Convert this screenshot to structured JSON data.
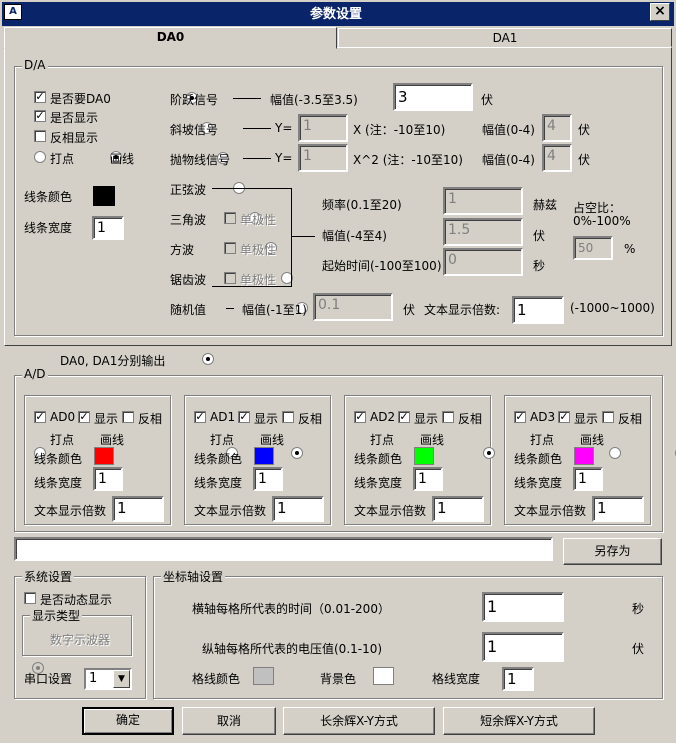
{
  "window": {
    "title": "参数设置",
    "close": "×",
    "icon": "A"
  },
  "tabs": [
    {
      "label": "DA0"
    },
    {
      "label": "DA1"
    }
  ],
  "da": {
    "legend": "D/A",
    "need_da0": "是否要DA0",
    "show": "是否显示",
    "invert": "反相显示",
    "dot": "打点",
    "line": "画线",
    "line_color": "线条颜色",
    "line_width": "线条宽度",
    "line_width_value": "1",
    "line_color_hex": "#000000",
    "step": {
      "label": "阶跃信号",
      "amp_label": "幅值(-3.5至3.5)",
      "amp_value": "3",
      "unit": "伏"
    },
    "ramp": {
      "label": "斜坡信号",
      "y": "Y=",
      "value": "1",
      "x_note": "X  (注：-10至10)",
      "amp": "幅值(0-4)",
      "amp_value": "4",
      "unit": "伏"
    },
    "parabola": {
      "label": "抛物线信号",
      "y": "Y=",
      "value": "1",
      "x_note": "X^2 (注：-10至10)",
      "amp": "幅值(0-4)",
      "amp_value": "4",
      "unit": "伏"
    },
    "sine": "正弦波",
    "triangle": "三角波",
    "square": "方波",
    "sawtooth": "锯齿波",
    "unipolar": "单极性",
    "freq": {
      "label": "频率(0.1至20)",
      "value": "1",
      "unit": "赫兹"
    },
    "amp": {
      "label": "幅值(-4至4)",
      "value": "1.5",
      "unit": "伏"
    },
    "start": {
      "label": "起始时间(-100至100)",
      "value": "0",
      "unit": "秒"
    },
    "duty": {
      "label1": "占空比：",
      "label2": "0%-100%",
      "value": "50",
      "unit": "%"
    },
    "random": {
      "label": "随机值",
      "amp": "幅值(-1至1)",
      "value": "0.1",
      "unit": "伏"
    },
    "text_scale": {
      "label": "文本显示倍数:",
      "value": "1",
      "range": "(-1000~1000)"
    }
  },
  "separate_output": "DA0, DA1分别输出",
  "ad": {
    "legend": "A/D",
    "show": "显示",
    "invert": "反相",
    "dot": "打点",
    "line": "画线",
    "line_color": "线条颜色",
    "line_width": "线条宽度",
    "text_scale": "文本显示倍数",
    "channels": [
      {
        "name": "AD0",
        "color": "#ff0000",
        "width": "1",
        "scale": "1"
      },
      {
        "name": "AD1",
        "color": "#0000ff",
        "width": "1",
        "scale": "1"
      },
      {
        "name": "AD2",
        "color": "#00ff00",
        "width": "1",
        "scale": "1"
      },
      {
        "name": "AD3",
        "color": "#ff00ff",
        "width": "1",
        "scale": "1"
      }
    ]
  },
  "save_as": "另存为",
  "system": {
    "legend": "系统设置",
    "dynamic": "是否动态显示",
    "display_type": "显示类型",
    "oscilloscope": "数字示波器",
    "serial": "串口设置",
    "serial_value": "1",
    "arrow": "▼"
  },
  "axis": {
    "legend": "坐标轴设置",
    "x_label": "横轴每格所代表的时间（0.01-200）",
    "x_value": "1",
    "x_unit": "秒",
    "y_label": "纵轴每格所代表的电压值(0.1-10)",
    "y_value": "1",
    "y_unit": "伏",
    "grid_color": "格线颜色",
    "grid_color_hex": "#c0c0c0",
    "bg_color": "背景色",
    "bg_color_hex": "#ffffff",
    "grid_width": "格线宽度",
    "grid_width_value": "1"
  },
  "buttons": {
    "ok": "确定",
    "cancel": "取消",
    "long": "长余辉X-Y方式",
    "short": "短余辉X-Y方式"
  }
}
